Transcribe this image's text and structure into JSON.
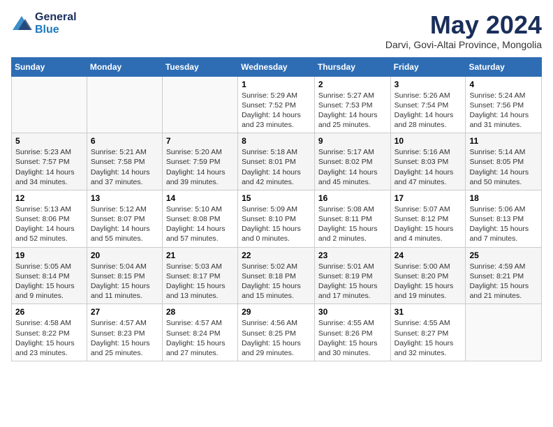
{
  "header": {
    "logo_general": "General",
    "logo_blue": "Blue",
    "month": "May 2024",
    "location": "Darvi, Govi-Altai Province, Mongolia"
  },
  "days_of_week": [
    "Sunday",
    "Monday",
    "Tuesday",
    "Wednesday",
    "Thursday",
    "Friday",
    "Saturday"
  ],
  "weeks": [
    [
      {
        "day": "",
        "info": ""
      },
      {
        "day": "",
        "info": ""
      },
      {
        "day": "",
        "info": ""
      },
      {
        "day": "1",
        "info": "Sunrise: 5:29 AM\nSunset: 7:52 PM\nDaylight: 14 hours\nand 23 minutes."
      },
      {
        "day": "2",
        "info": "Sunrise: 5:27 AM\nSunset: 7:53 PM\nDaylight: 14 hours\nand 25 minutes."
      },
      {
        "day": "3",
        "info": "Sunrise: 5:26 AM\nSunset: 7:54 PM\nDaylight: 14 hours\nand 28 minutes."
      },
      {
        "day": "4",
        "info": "Sunrise: 5:24 AM\nSunset: 7:56 PM\nDaylight: 14 hours\nand 31 minutes."
      }
    ],
    [
      {
        "day": "5",
        "info": "Sunrise: 5:23 AM\nSunset: 7:57 PM\nDaylight: 14 hours\nand 34 minutes."
      },
      {
        "day": "6",
        "info": "Sunrise: 5:21 AM\nSunset: 7:58 PM\nDaylight: 14 hours\nand 37 minutes."
      },
      {
        "day": "7",
        "info": "Sunrise: 5:20 AM\nSunset: 7:59 PM\nDaylight: 14 hours\nand 39 minutes."
      },
      {
        "day": "8",
        "info": "Sunrise: 5:18 AM\nSunset: 8:01 PM\nDaylight: 14 hours\nand 42 minutes."
      },
      {
        "day": "9",
        "info": "Sunrise: 5:17 AM\nSunset: 8:02 PM\nDaylight: 14 hours\nand 45 minutes."
      },
      {
        "day": "10",
        "info": "Sunrise: 5:16 AM\nSunset: 8:03 PM\nDaylight: 14 hours\nand 47 minutes."
      },
      {
        "day": "11",
        "info": "Sunrise: 5:14 AM\nSunset: 8:05 PM\nDaylight: 14 hours\nand 50 minutes."
      }
    ],
    [
      {
        "day": "12",
        "info": "Sunrise: 5:13 AM\nSunset: 8:06 PM\nDaylight: 14 hours\nand 52 minutes."
      },
      {
        "day": "13",
        "info": "Sunrise: 5:12 AM\nSunset: 8:07 PM\nDaylight: 14 hours\nand 55 minutes."
      },
      {
        "day": "14",
        "info": "Sunrise: 5:10 AM\nSunset: 8:08 PM\nDaylight: 14 hours\nand 57 minutes."
      },
      {
        "day": "15",
        "info": "Sunrise: 5:09 AM\nSunset: 8:10 PM\nDaylight: 15 hours\nand 0 minutes."
      },
      {
        "day": "16",
        "info": "Sunrise: 5:08 AM\nSunset: 8:11 PM\nDaylight: 15 hours\nand 2 minutes."
      },
      {
        "day": "17",
        "info": "Sunrise: 5:07 AM\nSunset: 8:12 PM\nDaylight: 15 hours\nand 4 minutes."
      },
      {
        "day": "18",
        "info": "Sunrise: 5:06 AM\nSunset: 8:13 PM\nDaylight: 15 hours\nand 7 minutes."
      }
    ],
    [
      {
        "day": "19",
        "info": "Sunrise: 5:05 AM\nSunset: 8:14 PM\nDaylight: 15 hours\nand 9 minutes."
      },
      {
        "day": "20",
        "info": "Sunrise: 5:04 AM\nSunset: 8:15 PM\nDaylight: 15 hours\nand 11 minutes."
      },
      {
        "day": "21",
        "info": "Sunrise: 5:03 AM\nSunset: 8:17 PM\nDaylight: 15 hours\nand 13 minutes."
      },
      {
        "day": "22",
        "info": "Sunrise: 5:02 AM\nSunset: 8:18 PM\nDaylight: 15 hours\nand 15 minutes."
      },
      {
        "day": "23",
        "info": "Sunrise: 5:01 AM\nSunset: 8:19 PM\nDaylight: 15 hours\nand 17 minutes."
      },
      {
        "day": "24",
        "info": "Sunrise: 5:00 AM\nSunset: 8:20 PM\nDaylight: 15 hours\nand 19 minutes."
      },
      {
        "day": "25",
        "info": "Sunrise: 4:59 AM\nSunset: 8:21 PM\nDaylight: 15 hours\nand 21 minutes."
      }
    ],
    [
      {
        "day": "26",
        "info": "Sunrise: 4:58 AM\nSunset: 8:22 PM\nDaylight: 15 hours\nand 23 minutes."
      },
      {
        "day": "27",
        "info": "Sunrise: 4:57 AM\nSunset: 8:23 PM\nDaylight: 15 hours\nand 25 minutes."
      },
      {
        "day": "28",
        "info": "Sunrise: 4:57 AM\nSunset: 8:24 PM\nDaylight: 15 hours\nand 27 minutes."
      },
      {
        "day": "29",
        "info": "Sunrise: 4:56 AM\nSunset: 8:25 PM\nDaylight: 15 hours\nand 29 minutes."
      },
      {
        "day": "30",
        "info": "Sunrise: 4:55 AM\nSunset: 8:26 PM\nDaylight: 15 hours\nand 30 minutes."
      },
      {
        "day": "31",
        "info": "Sunrise: 4:55 AM\nSunset: 8:27 PM\nDaylight: 15 hours\nand 32 minutes."
      },
      {
        "day": "",
        "info": ""
      }
    ]
  ]
}
